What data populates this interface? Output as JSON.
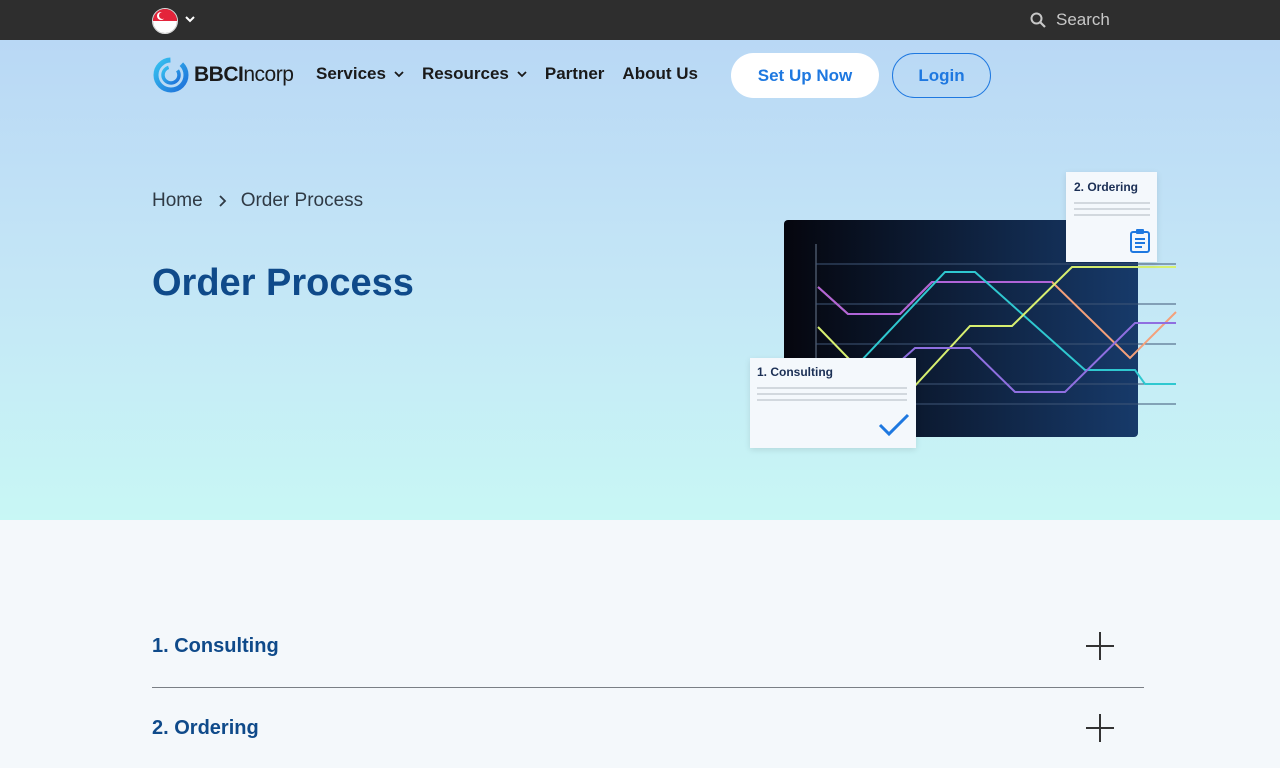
{
  "topbar": {
    "language_flag": "Singapore",
    "search_label": "Search"
  },
  "brand": {
    "logo_bold": "BBCI",
    "logo_thin": "ncorp"
  },
  "nav": {
    "items": [
      {
        "label": "Services",
        "has_dropdown": true
      },
      {
        "label": "Resources",
        "has_dropdown": true
      },
      {
        "label": "Partner",
        "has_dropdown": false
      },
      {
        "label": "About Us",
        "has_dropdown": false
      }
    ],
    "setup_button": "Set Up Now",
    "login_button": "Login"
  },
  "breadcrumb": {
    "home": "Home",
    "current": "Order Process"
  },
  "page": {
    "title": "Order Process"
  },
  "illustration": {
    "card_consulting": "1. Consulting",
    "card_ordering": "2. Ordering"
  },
  "accordion": [
    {
      "title": "1. Consulting"
    },
    {
      "title": "2. Ordering"
    }
  ],
  "colors": {
    "accent": "#1e78e0",
    "heading": "#0f4a8a",
    "topbar": "#2e2e2e"
  }
}
